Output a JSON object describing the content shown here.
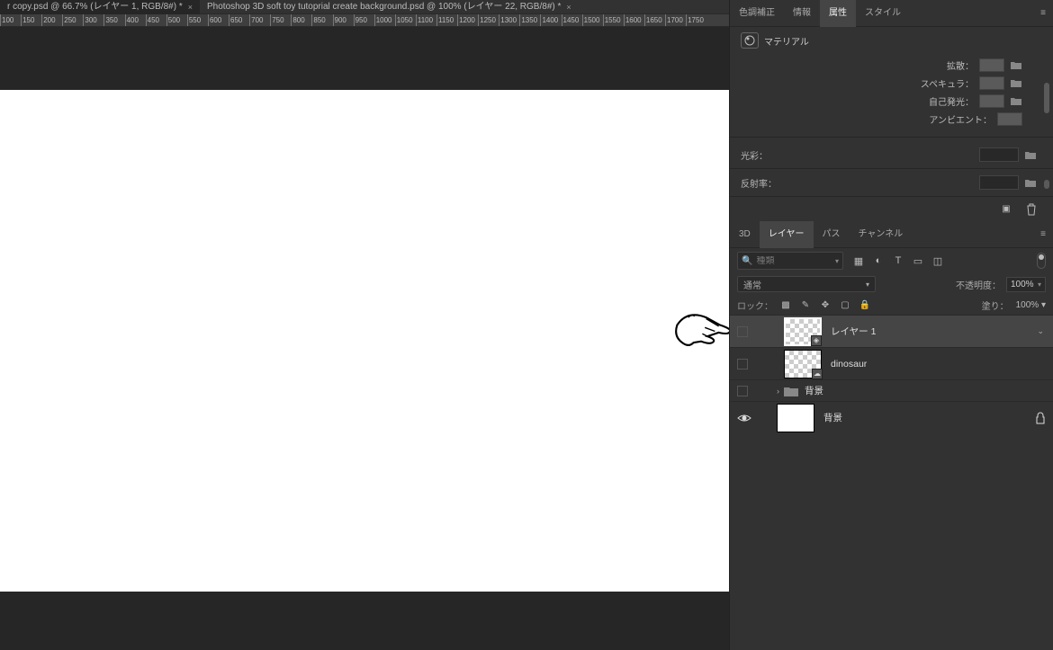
{
  "tabs": [
    {
      "label": "r copy.psd @ 66.7% (レイヤー 1, RGB/8#) *"
    },
    {
      "label": "Photoshop 3D soft toy tutoprial create background.psd @ 100% (レイヤー 22, RGB/8#) *"
    }
  ],
  "ruler_values": [
    "100",
    "150",
    "200",
    "250",
    "300",
    "350",
    "400",
    "450",
    "500",
    "550",
    "600",
    "650",
    "700",
    "750",
    "800",
    "850",
    "900",
    "950",
    "1000",
    "1050",
    "1100",
    "1150",
    "1200",
    "1250",
    "1300",
    "1350",
    "1400",
    "1450",
    "1500",
    "1550",
    "1600",
    "1650",
    "1700",
    "1750"
  ],
  "properties_panel": {
    "tabs": [
      "色調補正",
      "情報",
      "属性",
      "スタイル"
    ],
    "active_tab": 2,
    "header": "マテリアル",
    "rows": {
      "diffuse": "拡散：",
      "specular": "スペキュラ：",
      "emissive": "自己発光：",
      "ambient": "アンビエント："
    },
    "gloss": "光彩：",
    "reflectivity": "反射率："
  },
  "layers_panel": {
    "tabs": [
      "3D",
      "レイヤー",
      "パス",
      "チャンネル"
    ],
    "active_tab": 1,
    "search_placeholder": "種類",
    "blend_mode": "通常",
    "opacity_label": "不透明度：",
    "opacity_value": "100%",
    "lock_label": "ロック：",
    "fill_label": "塗り：",
    "fill_value": "100%",
    "layers": [
      {
        "name": "レイヤー 1",
        "selected": true,
        "visible": false,
        "thumb": "checker",
        "badge": "cube"
      },
      {
        "name": "dinosaur",
        "selected": false,
        "visible": false,
        "thumb": "checker",
        "badge": "cloud"
      },
      {
        "name": "背景",
        "selected": false,
        "visible": false,
        "type": "group"
      },
      {
        "name": "背景",
        "selected": false,
        "visible": true,
        "thumb": "white",
        "locked": true
      }
    ]
  }
}
